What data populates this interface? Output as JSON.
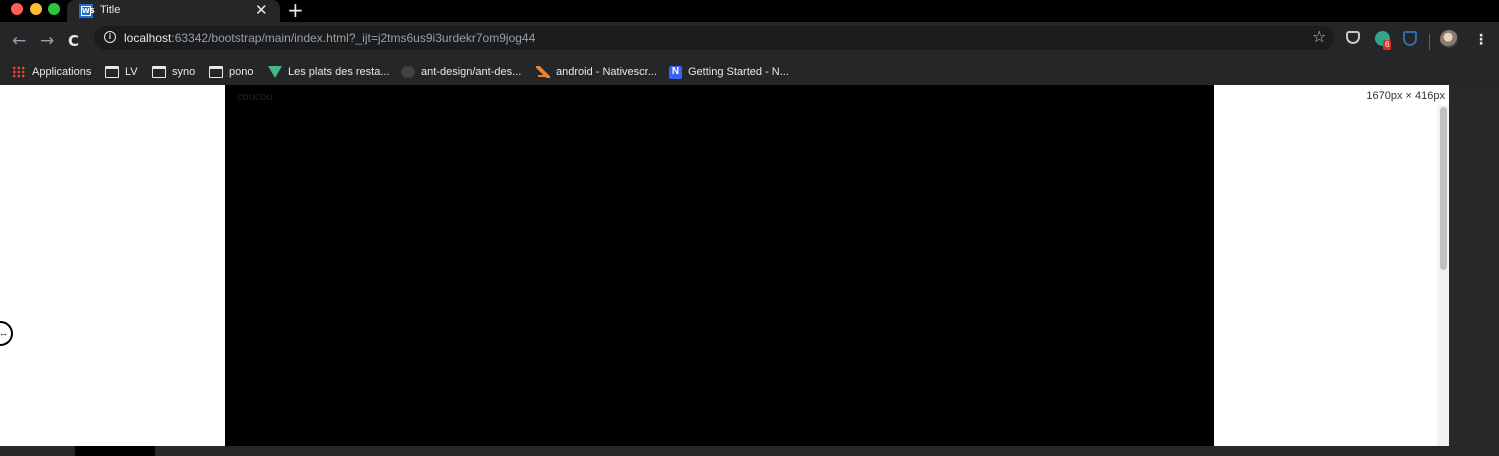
{
  "window": {
    "traffic_lights": {
      "close": "#ff5f57",
      "minimize": "#febc2e",
      "zoom": "#28c840"
    }
  },
  "tabs": [
    {
      "favicon": "WS",
      "title": "Title"
    }
  ],
  "tab_close_glyph": "✕",
  "new_tab_glyph": "+",
  "toolbar": {
    "back_glyph": "←",
    "forward_glyph": "→",
    "reload_glyph": "C",
    "url_host": "localhost",
    "url_rest": ":63342/bootstrap/main/index.html?_ijt=j2tms6us9i3urdekr7om9jog44",
    "star_glyph": "☆",
    "extension_badge": "6",
    "menu_glyph": "⋮"
  },
  "bookmarks": [
    {
      "icon": "apps-grid-icon",
      "label": "Applications"
    },
    {
      "icon": "folder-icon",
      "label": "LV"
    },
    {
      "icon": "folder-icon",
      "label": "syno"
    },
    {
      "icon": "folder-icon",
      "label": "pono"
    },
    {
      "icon": "vue-icon",
      "label": "Les plats des resta..."
    },
    {
      "icon": "github-icon",
      "label": "ant-design/ant-des..."
    },
    {
      "icon": "stackoverflow-icon",
      "label": "android - Nativescr..."
    },
    {
      "icon": "n-logo-icon",
      "label": "Getting Started - N..."
    }
  ],
  "page": {
    "block_text": "coucou",
    "viewport_size": "1670px × 416px",
    "resize_handle_glyph": "↔"
  },
  "colors": {
    "chrome_bg": "#252628",
    "page_bg": "#ffffff",
    "block_bg": "#000000"
  }
}
